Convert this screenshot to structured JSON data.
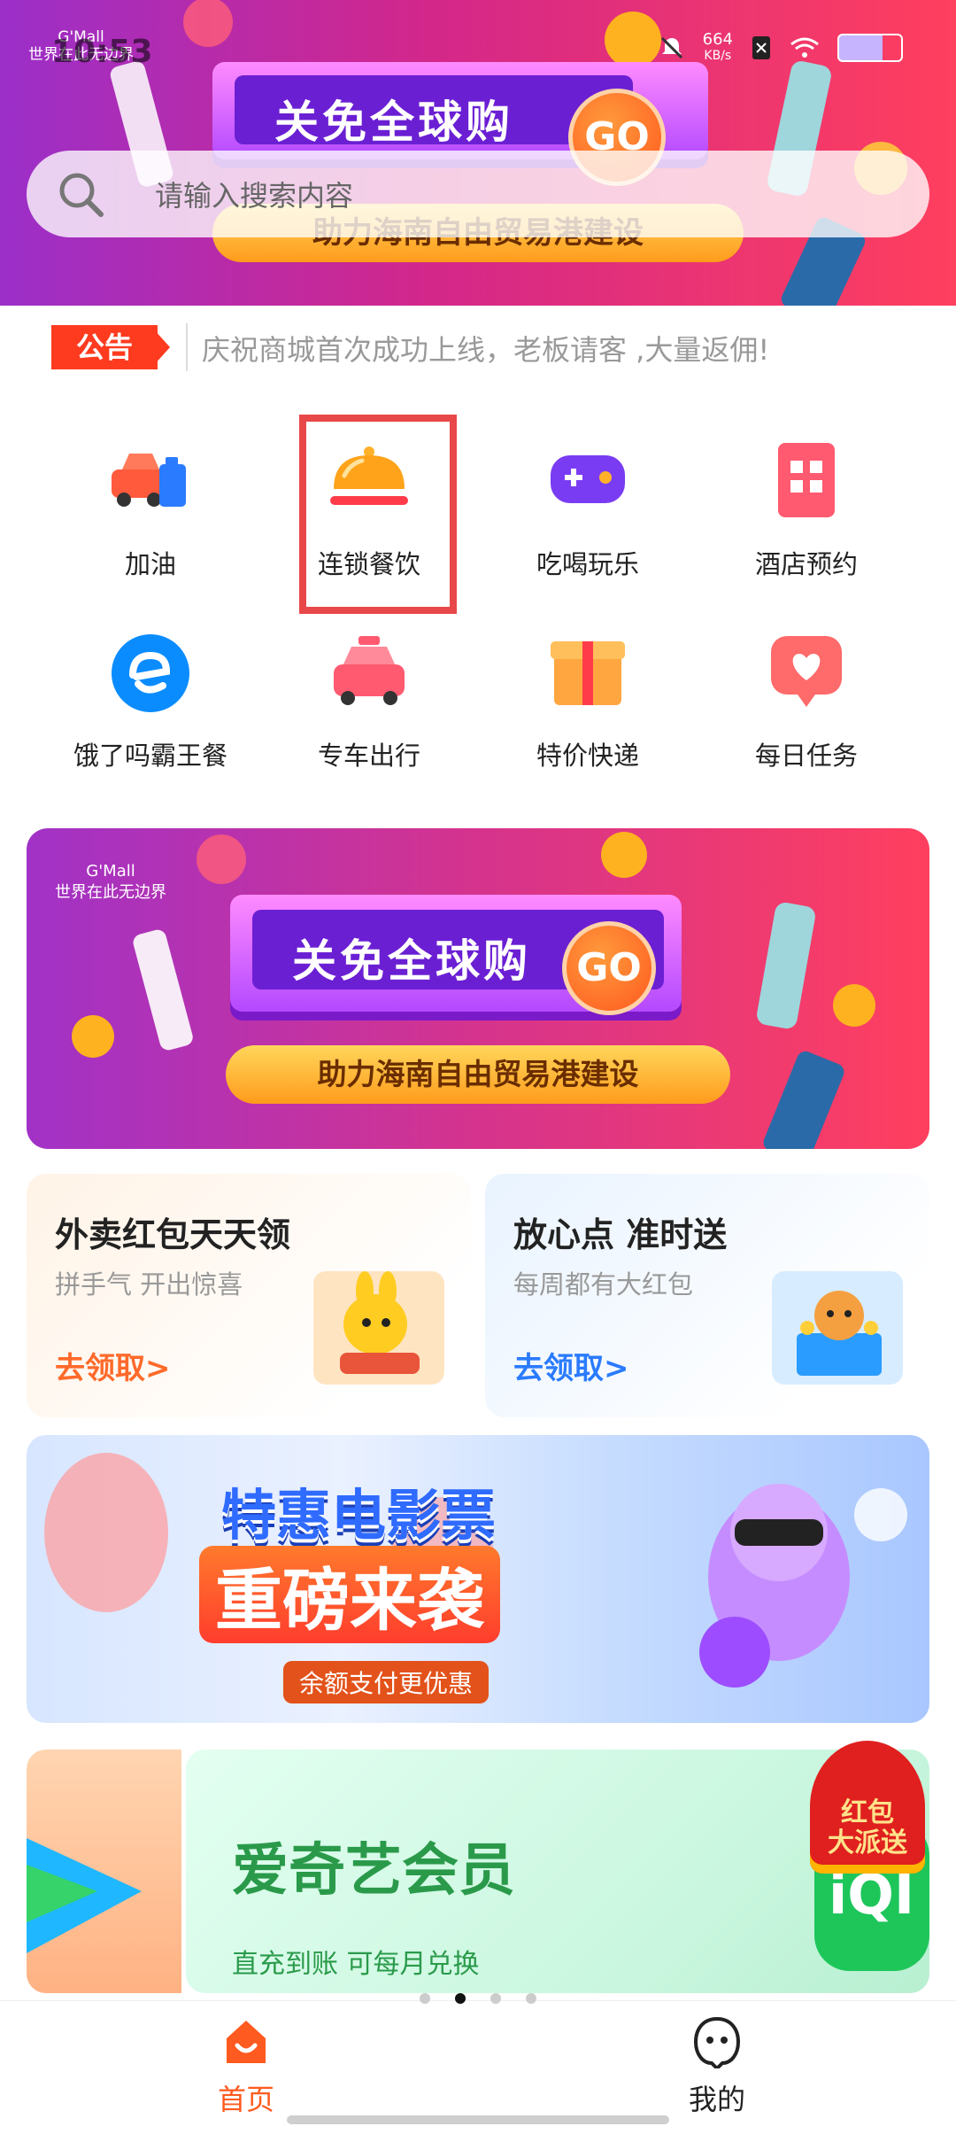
{
  "status_bar": {
    "time": "10:53",
    "net_speed_value": "664",
    "net_speed_unit": "KB/s"
  },
  "hero": {
    "brand_line1": "G'Mall",
    "brand_line2": "世界在此无边界",
    "headline": "关免全球购",
    "go": "GO",
    "tagline": "助力海南自由贸易港建设"
  },
  "search": {
    "placeholder": "请输入搜索内容"
  },
  "notice": {
    "tag": "公告",
    "text": "庆祝商城首次成功上线，老板请客 ,大量返佣!"
  },
  "grid": [
    {
      "label": "加油",
      "icon": "car-fuel-icon"
    },
    {
      "label": "连锁餐饮",
      "icon": "food-cloche-icon"
    },
    {
      "label": "吃喝玩乐",
      "icon": "game-controller-icon"
    },
    {
      "label": "酒店预约",
      "icon": "hotel-building-icon"
    },
    {
      "label": "饿了吗霸王餐",
      "icon": "eleme-logo-icon"
    },
    {
      "label": "专车出行",
      "icon": "taxi-icon"
    },
    {
      "label": "特价快递",
      "icon": "parcel-box-icon"
    },
    {
      "label": "每日任务",
      "icon": "heart-chat-icon"
    }
  ],
  "banner": {
    "brand_line1": "G'Mall",
    "brand_line2": "世界在此无边界",
    "headline": "关免全球购",
    "go": "GO",
    "tagline": "助力海南自由贸易港建设"
  },
  "promo_cards": [
    {
      "title": "外卖红包天天领",
      "subtitle": "拼手气 开出惊喜",
      "link": "去领取>",
      "accent": "#ff6a2a"
    },
    {
      "title": "放心点  准时送",
      "subtitle": "每周都有大红包",
      "link": "去领取>",
      "accent": "#2a7bff"
    }
  ],
  "movie_banner": {
    "line1": "特惠电影票",
    "line2": "重磅来袭",
    "line3": "余额支付更优惠"
  },
  "iqiyi_banner": {
    "title": "爱奇艺会员",
    "subtitle": "直充到账 可每月兑换",
    "logo_text": "iQI"
  },
  "floating_red_packet": {
    "line1": "红包",
    "line2": "大派送"
  },
  "carousel": {
    "dot_count": 4,
    "active_index": 1
  },
  "tabbar": {
    "home": "首页",
    "me": "我的",
    "home_color": "#ff5a1f"
  }
}
